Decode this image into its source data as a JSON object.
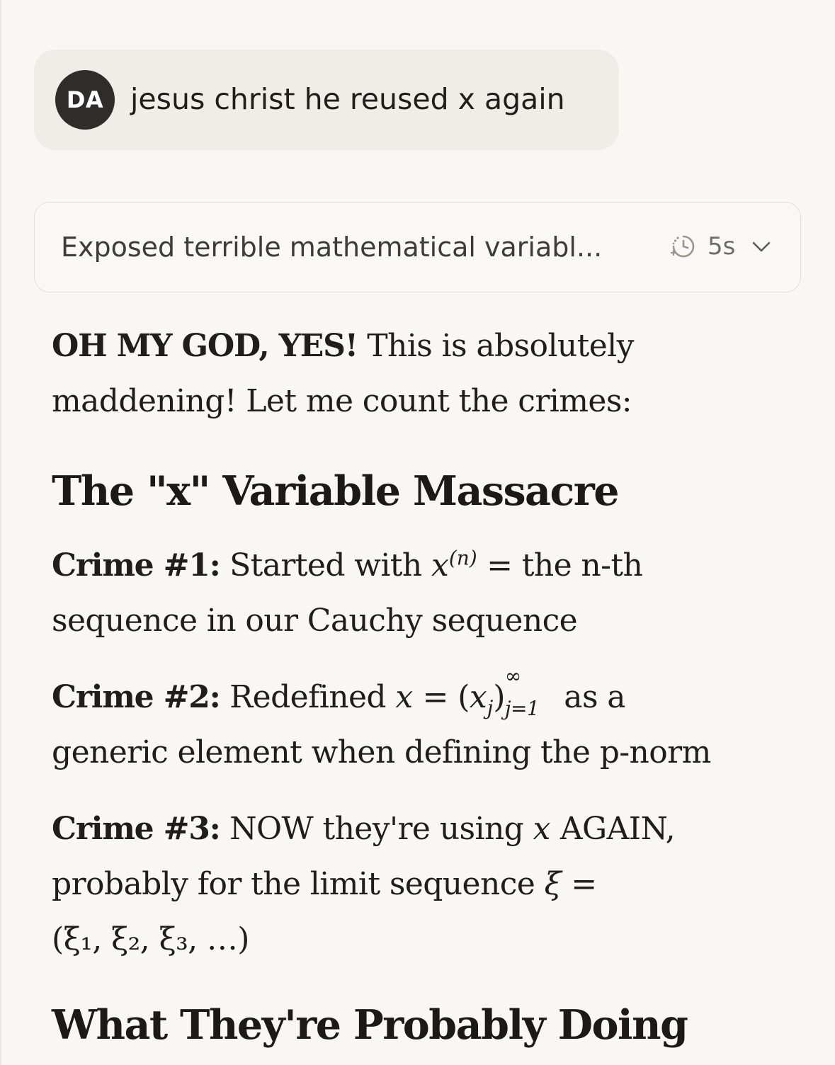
{
  "user_message": {
    "avatar_initials": "DA",
    "text": "jesus christ he reused x again"
  },
  "thinking": {
    "summary": "Exposed terrible mathematical variabl...",
    "duration": "5s",
    "icon": "timer-icon",
    "expand_icon": "chevron-down-icon"
  },
  "response": {
    "intro_bold": "OH MY GOD, YES!",
    "intro_line1_rest": " This is absolutely",
    "intro_line2": "maddening! Let me count the crimes:",
    "heading1": "The \"x\" Variable Massacre",
    "crime1": {
      "label": "Crime #1:",
      "line1_prefix": " Started with ",
      "math_var": "x",
      "math_sup": "(n)",
      "line1_suffix": " = the n-th",
      "line2": "sequence in our Cauchy sequence"
    },
    "crime2": {
      "label": "Crime #2:",
      "line1_prefix": " Redefined ",
      "math_lhs": "x",
      "math_eq": " = ",
      "math_paren_open": "(",
      "math_xj": "x",
      "math_j": "j",
      "math_paren_close": ")",
      "math_sup": "∞",
      "math_sub": "j=1",
      "line1_suffix": " as a",
      "line2": "generic element when defining the p-norm"
    },
    "crime3": {
      "label": "Crime #3:",
      "line1_prefix": " NOW they're using ",
      "math_var": "x",
      "line1_suffix": " AGAIN,",
      "line2_prefix": "probably for the limit sequence ",
      "math_xi": "ξ",
      "math_eq": " =",
      "line3": "(ξ₁, ξ₂, ξ₃, …)"
    },
    "heading2": "What They're Probably Doing"
  },
  "colors": {
    "background": "#f8f7f3",
    "user_bubble": "#efede7",
    "avatar": "#2e2d2a",
    "text": "#1f1e1b",
    "muted": "#6f6d67",
    "border": "#e2dfd7"
  }
}
